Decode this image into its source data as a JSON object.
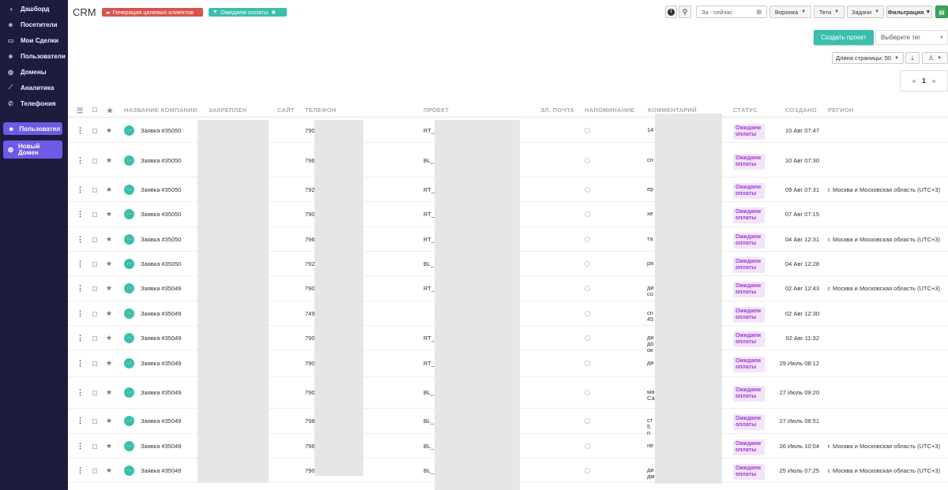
{
  "sidebar": {
    "items": [
      {
        "label": "Дашборд",
        "icon": "dashboard-icon",
        "glyph": "◑"
      },
      {
        "label": "Посетители",
        "icon": "visitors-icon",
        "glyph": "☻"
      },
      {
        "label": "Мои Сделки",
        "icon": "deals-icon",
        "glyph": "▭"
      },
      {
        "label": "Пользователи",
        "icon": "users-icon",
        "glyph": "☻"
      },
      {
        "label": "Домены",
        "icon": "globe-icon",
        "glyph": "◍"
      },
      {
        "label": "Аналитика",
        "icon": "chart-icon",
        "glyph": "⟋"
      },
      {
        "label": "Телефония",
        "icon": "phone-icon",
        "glyph": "✆"
      }
    ],
    "user_button": "Пользовател",
    "domain_button_line1": "Новый",
    "domain_button_line2": "Домен"
  },
  "header": {
    "title": "CRM",
    "chip_red": "Генерация целевых клиентов",
    "chip_teal": "Ожидаем оплаты",
    "date_placeholder": "За - сейчас",
    "funnel": "Воронка",
    "tags": "Теги",
    "tasks": "Задачи",
    "filter": "Фильтрация",
    "create_project": "Создать проект",
    "tag_select": "Выберите тег",
    "page_length": "Длина страницы: 50",
    "pager_prev": "«",
    "pager_current": "1",
    "pager_next": "»"
  },
  "table": {
    "headers": {
      "company": "НАЗВАНИЕ КОМПАНИИ",
      "pinned": "ЗАКРЕПЛЕН",
      "site": "САЙТ",
      "phone": "ТЕЛЕФОН",
      "project": "ПРОЕКТ",
      "email": "ЭЛ. ПОЧТА",
      "reminder": "НАПОМИНАНИЕ",
      "comment": "КОММЕНТАРИЙ",
      "status": "СТАТУС",
      "created": "СОЗДАНО",
      "region": "РЕГИОН"
    },
    "rows": [
      {
        "name": "Заявка #35050",
        "phone": "790",
        "project": "RT_",
        "comment": "14",
        "status": "Ожидаем оплаты",
        "created": "10 Авг 07:47",
        "region": ""
      },
      {
        "name": "Заявка #35050",
        "phone": "796",
        "project": "BL_",
        "comment": "сн",
        "status": "Ожидаем оплаты",
        "created": "10 Авг 07:30",
        "region": ""
      },
      {
        "name": "Заявка #35050",
        "phone": "792",
        "project": "RT_",
        "comment": "ер",
        "status": "Ожидаем оплаты",
        "created": "09 Авг 07:31",
        "region": "г. Москва и Московская область (UTC+3)"
      },
      {
        "name": "Заявка #35050",
        "phone": "790",
        "project": "RT_",
        "comment": "хе",
        "status": "Ожидаем оплаты",
        "created": "07 Авг 07:15",
        "region": ""
      },
      {
        "name": "Заявка #35050",
        "phone": "796",
        "project": "RT_",
        "comment": "та",
        "status": "Ожидаем оплаты",
        "created": "04 Авг 12:31",
        "region": "г. Москва и Московская область (UTC+3)"
      },
      {
        "name": "Заявка #35050",
        "phone": "792",
        "project": "BL_",
        "comment": "ря",
        "status": "Ожидаем оплаты",
        "created": "04 Авг 12:28",
        "region": ""
      },
      {
        "name": "Заявка #35049",
        "phone": "790",
        "project": "RT_",
        "comment": "ди со",
        "status": "Ожидаем оплаты",
        "created": "02 Авг 12:43",
        "region": "г. Москва и Московская область (UTC+3)"
      },
      {
        "name": "Заявка #35049",
        "phone": "7495",
        "project": "",
        "comment": "сп 45",
        "status": "Ожидаем оплаты",
        "created": "02 Авг 12:30",
        "region": ""
      },
      {
        "name": "Заявка #35049",
        "phone": "790",
        "project": "RT_",
        "comment": "ди до ок",
        "status": "Ожидаем оплаты",
        "created": "02 Авг 11:32",
        "region": ""
      },
      {
        "name": "Заявка #35049",
        "phone": "790",
        "project": "RT_",
        "comment": "ди",
        "status": "Ожидаем оплаты",
        "created": "29 Июль 08:12",
        "region": ""
      },
      {
        "name": "Заявка #35049",
        "phone": "790",
        "project": "BL_",
        "comment": "ма Са",
        "status": "Ожидаем оплаты",
        "created": "27 Июль 09:20",
        "region": ""
      },
      {
        "name": "Заявка #35049",
        "phone": "798",
        "project": "BL_",
        "comment": "ст 5 п",
        "status": "Ожидаем оплаты",
        "created": "27 Июль 08:51",
        "region": ""
      },
      {
        "name": "Заявка #35049",
        "phone": "796",
        "project": "BL_",
        "comment": "пе",
        "status": "Ожидаем оплаты",
        "created": "26 Июль 10:04",
        "region": "г. Москва и Московская область (UTC+3)"
      },
      {
        "name": "Заявка #35049",
        "phone": "790",
        "project": "BL_",
        "comment": "ди дм",
        "status": "Ожидаем оплаты",
        "created": "25 Июль 07:25",
        "region": "г. Москва и Московская область (UTC+3)"
      }
    ]
  }
}
